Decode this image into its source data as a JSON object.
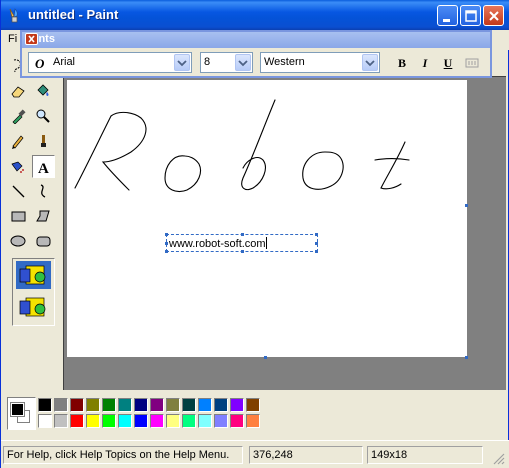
{
  "window": {
    "title": "untitled - Paint"
  },
  "menubar": {
    "file_label": "Fi"
  },
  "fonts_toolbar": {
    "title": "Fonts",
    "font_icon": "opentype-font-icon",
    "font_name": "Arial",
    "font_size": "8",
    "script": "Western",
    "bold_label": "B",
    "italic_label": "I",
    "underline_label": "U",
    "vertical_text_icon": "vertical-text-icon"
  },
  "tools": [
    {
      "name": "free-form-select-icon",
      "active": false
    },
    {
      "name": "select-icon",
      "active": false
    },
    {
      "name": "eraser-icon",
      "active": false
    },
    {
      "name": "fill-bucket-icon",
      "active": false
    },
    {
      "name": "pick-color-icon",
      "active": false
    },
    {
      "name": "magnifier-icon",
      "active": false
    },
    {
      "name": "pencil-icon",
      "active": false
    },
    {
      "name": "brush-icon",
      "active": false
    },
    {
      "name": "airbrush-icon",
      "active": false
    },
    {
      "name": "text-tool-icon",
      "active": true
    },
    {
      "name": "line-icon",
      "active": false
    },
    {
      "name": "curve-icon",
      "active": false
    },
    {
      "name": "rectangle-icon",
      "active": false
    },
    {
      "name": "polygon-icon",
      "active": false
    },
    {
      "name": "ellipse-icon",
      "active": false
    },
    {
      "name": "rounded-rectangle-icon",
      "active": false
    }
  ],
  "tool_options": [
    {
      "name": "opaque-background-option",
      "selected": true
    },
    {
      "name": "transparent-background-option",
      "selected": false
    }
  ],
  "canvas": {
    "drawn_text": "Robot",
    "textbox_value": "www.robot-soft.com"
  },
  "palette": {
    "foreground": "#000000",
    "background": "#ffffff",
    "row1": [
      "#000000",
      "#808080",
      "#800000",
      "#808000",
      "#008000",
      "#008080",
      "#000080",
      "#800080",
      "#808040",
      "#004040",
      "#0080ff",
      "#004080",
      "#8000ff",
      "#804000"
    ],
    "row2": [
      "#ffffff",
      "#c0c0c0",
      "#ff0000",
      "#ffff00",
      "#00ff00",
      "#00ffff",
      "#0000ff",
      "#ff00ff",
      "#ffff80",
      "#00ff80",
      "#80ffff",
      "#8080ff",
      "#ff0080",
      "#ff8040"
    ]
  },
  "statusbar": {
    "help_text": "For Help, click Help Topics on the Help Menu.",
    "position": "376,248",
    "size": "149x18"
  }
}
